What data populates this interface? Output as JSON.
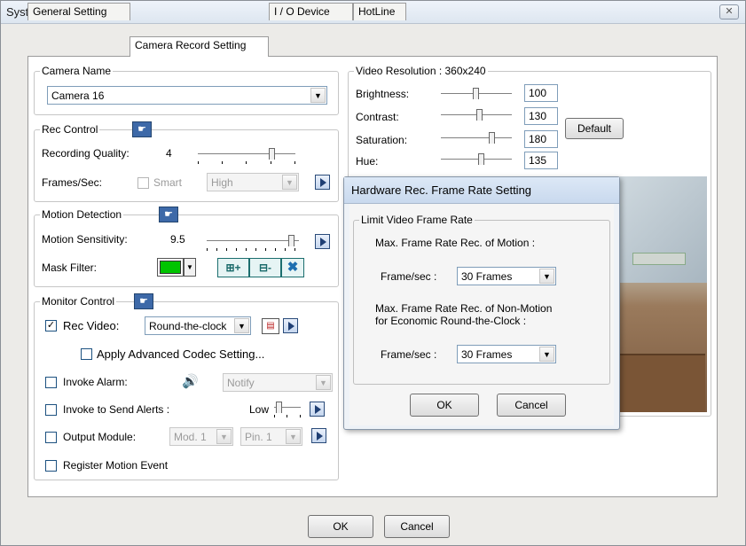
{
  "window": {
    "title": "System Configure",
    "close": "✕"
  },
  "tabs": [
    "General Setting",
    "Camera Record Setting",
    "I / O Device",
    "HotLine"
  ],
  "camera_name": {
    "legend": "Camera Name",
    "value": "Camera 16"
  },
  "rec_control": {
    "legend": "Rec Control",
    "quality_label": "Recording Quality:",
    "quality_value": "4",
    "fps_label": "Frames/Sec:",
    "smart_label": "Smart",
    "fps_select": "High"
  },
  "motion": {
    "legend": "Motion Detection",
    "sensitivity_label": "Motion Sensitivity:",
    "sensitivity_value": "9.5",
    "mask_label": "Mask Filter:"
  },
  "monitor": {
    "legend": "Monitor Control",
    "rec_video_label": "Rec Video:",
    "rec_video_value": "Round-the-clock",
    "advanced_codec": "Apply Advanced Codec Setting...",
    "invoke_alarm": "Invoke Alarm:",
    "alarm_select": "Notify",
    "send_alerts": "Invoke to Send Alerts :",
    "alerts_level": "Low",
    "output_module": "Output Module:",
    "mod_select": "Mod. 1",
    "pin_select": "Pin. 1",
    "register_motion": "Register Motion Event"
  },
  "video": {
    "legend": "Video Resolution : 360x240",
    "brightness_label": "Brightness:",
    "brightness": "100",
    "contrast_label": "Contrast:",
    "contrast": "130",
    "saturation_label": "Saturation:",
    "saturation": "180",
    "hue_label": "Hue:",
    "hue": "135",
    "default_btn": "Default"
  },
  "dialog": {
    "title": "Hardware Rec. Frame Rate Setting",
    "legend": "Limit Video Frame Rate",
    "motion_label": "Max. Frame Rate Rec. of Motion :",
    "fps_label": "Frame/sec :",
    "motion_value": "30 Frames",
    "nonmotion_label1": "Max. Frame Rate Rec. of Non-Motion",
    "nonmotion_label2": "for Economic Round-the-Clock :",
    "fps_label2": "Frame/sec :",
    "nonmotion_value": "30 Frames",
    "ok": "OK",
    "cancel": "Cancel"
  },
  "footer": {
    "ok": "OK",
    "cancel": "Cancel"
  },
  "colors": {
    "mask_color": "#00c400",
    "title_bg": "#dde6f0"
  }
}
